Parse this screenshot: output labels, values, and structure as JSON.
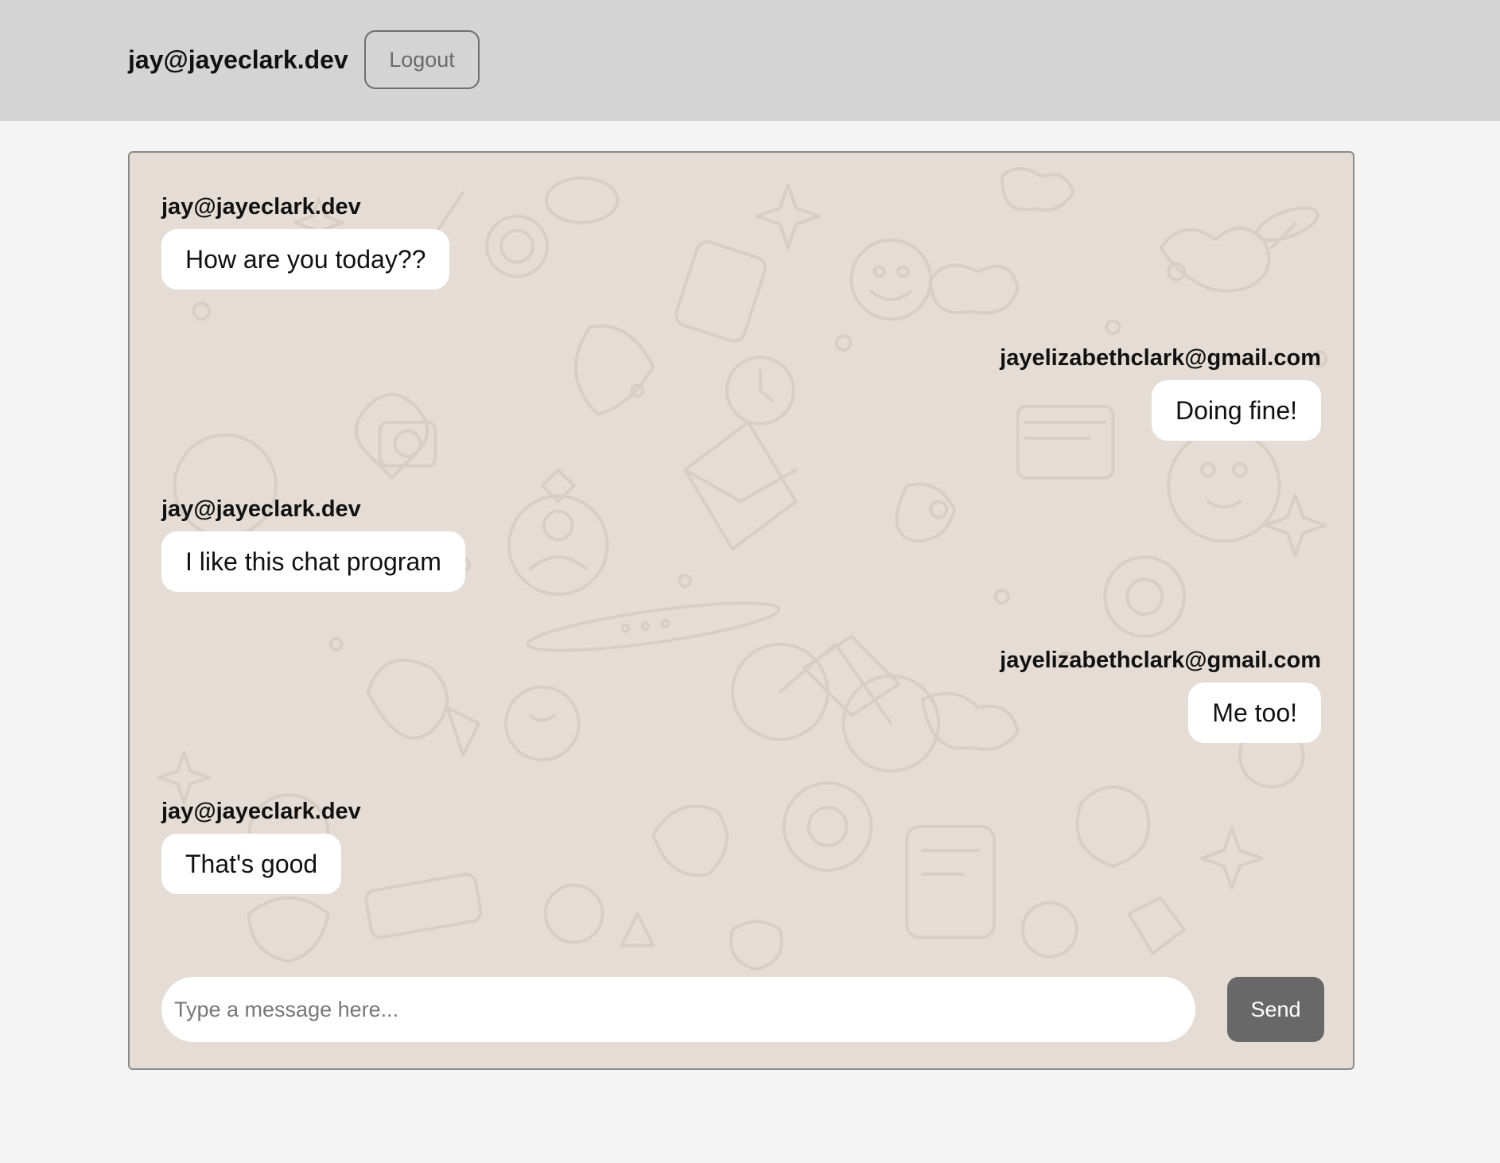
{
  "header": {
    "user_email": "jay@jayeclark.dev",
    "logout_label": "Logout"
  },
  "messages": [
    {
      "sender": "jay@jayeclark.dev",
      "text": "How are you today??",
      "side": "left"
    },
    {
      "sender": "jayelizabethclark@gmail.com",
      "text": "Doing fine!",
      "side": "right"
    },
    {
      "sender": "jay@jayeclark.dev",
      "text": "I like this chat program",
      "side": "left"
    },
    {
      "sender": "jayelizabethclark@gmail.com",
      "text": "Me too!",
      "side": "right"
    },
    {
      "sender": "jay@jayeclark.dev",
      "text": "That's good",
      "side": "left"
    }
  ],
  "composer": {
    "placeholder": "Type a message here...",
    "value": "",
    "send_label": "Send"
  },
  "colors": {
    "header_bg": "#d4d4d4",
    "page_bg": "#f4f4f4",
    "chat_bg": "#e5ddd5",
    "bubble_bg": "#ffffff",
    "send_button_bg": "#686868"
  },
  "background_pattern": "doodle-wallpaper"
}
